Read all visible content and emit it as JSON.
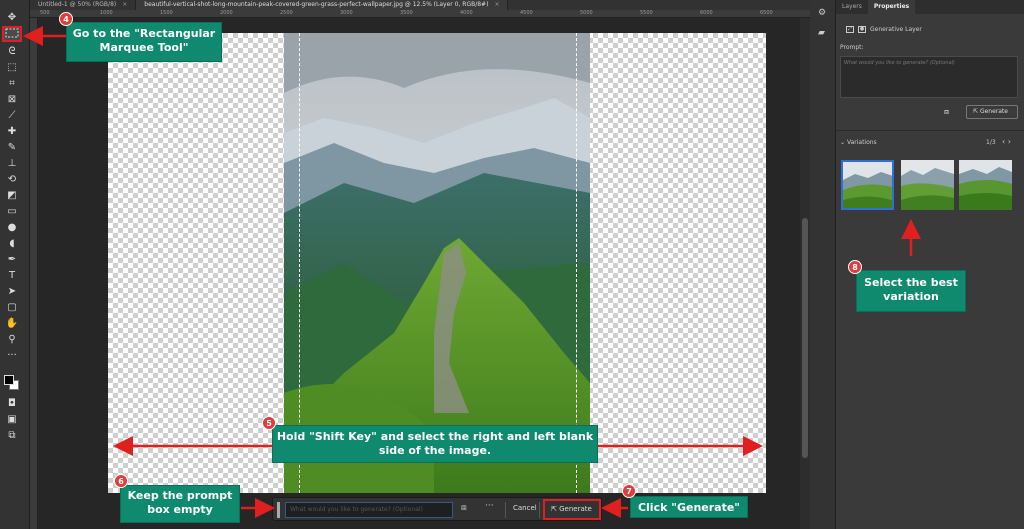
{
  "tabs": [
    {
      "label": "Untitled-1 @ 50% (RGB/8)",
      "close": "×"
    },
    {
      "label": "beautiful-vertical-shot-long-mountain-peak-covered-green-grass-perfect-wallpaper.jpg @ 12.5% (Layer 0, RGB/8#)",
      "close": "×"
    }
  ],
  "ruler": [
    "500",
    "1000",
    "1500",
    "2000",
    "2500",
    "3000",
    "3500",
    "4000",
    "4500",
    "5000",
    "5500",
    "6000",
    "6500"
  ],
  "contextual_bar": {
    "prompt_placeholder": "What would you like to generate? (Optional)",
    "more_label": "···",
    "cancel_label": "Cancel",
    "generate_label": "Generate",
    "generate_icon": "⇱"
  },
  "panel": {
    "tabs": [
      "Layers",
      "Properties"
    ],
    "layer_name": "Generative Layer",
    "prompt_label": "Prompt:",
    "prompt_placeholder": "What would you like to generate? (Optional)",
    "generate_label": "Generate",
    "generate_icon": "⇱",
    "variations_label": "Variations",
    "variations_count": "1/3",
    "variations_nav": "‹ ›"
  },
  "annotations": {
    "step4": {
      "num": "4",
      "text": "Go to the \"Rectangular Marquee Tool\""
    },
    "step5": {
      "num": "5",
      "text": "Hold \"Shift Key\" and select the right and left blank side of the image."
    },
    "step6": {
      "num": "6",
      "text": "Keep the prompt box empty"
    },
    "step7": {
      "num": "7",
      "text": "Click \"Generate\""
    },
    "step8": {
      "num": "8",
      "text": "Select the best variation"
    }
  },
  "colors": {
    "callout": "#0f8a6e",
    "arrow": "#e01f1f",
    "selection": "#2f6fd6"
  },
  "icons": [
    "move-icon",
    "rectangular-marquee-icon",
    "lasso-icon",
    "object-select-icon",
    "crop-icon",
    "frame-icon",
    "eyedropper-icon",
    "healing-icon",
    "brush-icon",
    "stamp-icon",
    "history-brush-icon",
    "eraser-icon",
    "gradient-icon",
    "blur-icon",
    "dodge-icon",
    "pen-icon",
    "type-icon",
    "path-select-icon",
    "rectangle-icon",
    "hand-icon",
    "zoom-icon"
  ]
}
